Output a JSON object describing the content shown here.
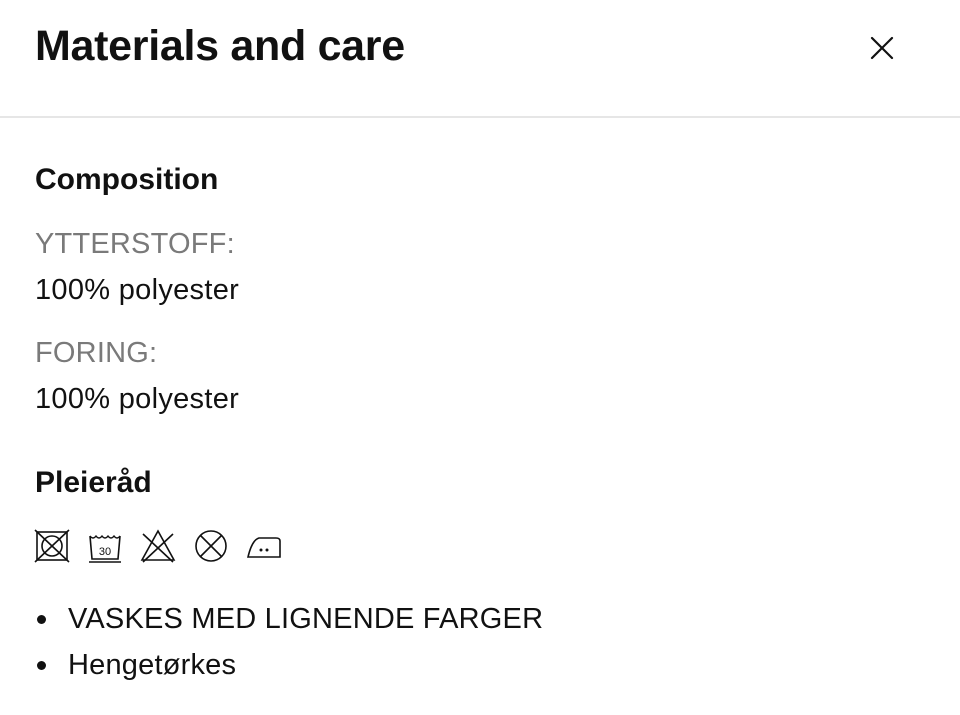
{
  "header": {
    "title": "Materials and care",
    "close_icon": "close-icon"
  },
  "composition": {
    "heading": "Composition",
    "items": [
      {
        "label": "YTTERSTOFF:",
        "value": "100% polyester"
      },
      {
        "label": "FORING:",
        "value": "100% polyester"
      }
    ]
  },
  "care": {
    "heading": "Pleieråd",
    "icons": [
      {
        "name": "do-not-tumble-dry-icon"
      },
      {
        "name": "wash-30-icon",
        "text": "30"
      },
      {
        "name": "do-not-bleach-icon"
      },
      {
        "name": "do-not-dry-clean-icon"
      },
      {
        "name": "iron-medium-heat-icon"
      }
    ],
    "instructions": [
      "VASKES MED LIGNENDE FARGER",
      "Hengetørkes"
    ]
  }
}
